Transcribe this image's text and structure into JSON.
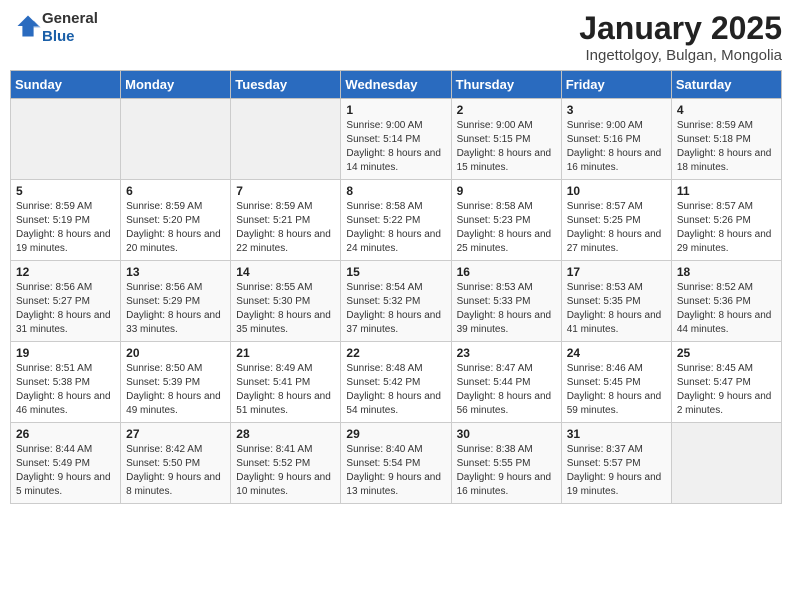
{
  "header": {
    "logo_general": "General",
    "logo_blue": "Blue",
    "title": "January 2025",
    "subtitle": "Ingettolgoy, Bulgan, Mongolia"
  },
  "days_of_week": [
    "Sunday",
    "Monday",
    "Tuesday",
    "Wednesday",
    "Thursday",
    "Friday",
    "Saturday"
  ],
  "weeks": [
    [
      {
        "day": "",
        "info": ""
      },
      {
        "day": "",
        "info": ""
      },
      {
        "day": "",
        "info": ""
      },
      {
        "day": "1",
        "info": "Sunrise: 9:00 AM\nSunset: 5:14 PM\nDaylight: 8 hours and 14 minutes."
      },
      {
        "day": "2",
        "info": "Sunrise: 9:00 AM\nSunset: 5:15 PM\nDaylight: 8 hours and 15 minutes."
      },
      {
        "day": "3",
        "info": "Sunrise: 9:00 AM\nSunset: 5:16 PM\nDaylight: 8 hours and 16 minutes."
      },
      {
        "day": "4",
        "info": "Sunrise: 8:59 AM\nSunset: 5:18 PM\nDaylight: 8 hours and 18 minutes."
      }
    ],
    [
      {
        "day": "5",
        "info": "Sunrise: 8:59 AM\nSunset: 5:19 PM\nDaylight: 8 hours and 19 minutes."
      },
      {
        "day": "6",
        "info": "Sunrise: 8:59 AM\nSunset: 5:20 PM\nDaylight: 8 hours and 20 minutes."
      },
      {
        "day": "7",
        "info": "Sunrise: 8:59 AM\nSunset: 5:21 PM\nDaylight: 8 hours and 22 minutes."
      },
      {
        "day": "8",
        "info": "Sunrise: 8:58 AM\nSunset: 5:22 PM\nDaylight: 8 hours and 24 minutes."
      },
      {
        "day": "9",
        "info": "Sunrise: 8:58 AM\nSunset: 5:23 PM\nDaylight: 8 hours and 25 minutes."
      },
      {
        "day": "10",
        "info": "Sunrise: 8:57 AM\nSunset: 5:25 PM\nDaylight: 8 hours and 27 minutes."
      },
      {
        "day": "11",
        "info": "Sunrise: 8:57 AM\nSunset: 5:26 PM\nDaylight: 8 hours and 29 minutes."
      }
    ],
    [
      {
        "day": "12",
        "info": "Sunrise: 8:56 AM\nSunset: 5:27 PM\nDaylight: 8 hours and 31 minutes."
      },
      {
        "day": "13",
        "info": "Sunrise: 8:56 AM\nSunset: 5:29 PM\nDaylight: 8 hours and 33 minutes."
      },
      {
        "day": "14",
        "info": "Sunrise: 8:55 AM\nSunset: 5:30 PM\nDaylight: 8 hours and 35 minutes."
      },
      {
        "day": "15",
        "info": "Sunrise: 8:54 AM\nSunset: 5:32 PM\nDaylight: 8 hours and 37 minutes."
      },
      {
        "day": "16",
        "info": "Sunrise: 8:53 AM\nSunset: 5:33 PM\nDaylight: 8 hours and 39 minutes."
      },
      {
        "day": "17",
        "info": "Sunrise: 8:53 AM\nSunset: 5:35 PM\nDaylight: 8 hours and 41 minutes."
      },
      {
        "day": "18",
        "info": "Sunrise: 8:52 AM\nSunset: 5:36 PM\nDaylight: 8 hours and 44 minutes."
      }
    ],
    [
      {
        "day": "19",
        "info": "Sunrise: 8:51 AM\nSunset: 5:38 PM\nDaylight: 8 hours and 46 minutes."
      },
      {
        "day": "20",
        "info": "Sunrise: 8:50 AM\nSunset: 5:39 PM\nDaylight: 8 hours and 49 minutes."
      },
      {
        "day": "21",
        "info": "Sunrise: 8:49 AM\nSunset: 5:41 PM\nDaylight: 8 hours and 51 minutes."
      },
      {
        "day": "22",
        "info": "Sunrise: 8:48 AM\nSunset: 5:42 PM\nDaylight: 8 hours and 54 minutes."
      },
      {
        "day": "23",
        "info": "Sunrise: 8:47 AM\nSunset: 5:44 PM\nDaylight: 8 hours and 56 minutes."
      },
      {
        "day": "24",
        "info": "Sunrise: 8:46 AM\nSunset: 5:45 PM\nDaylight: 8 hours and 59 minutes."
      },
      {
        "day": "25",
        "info": "Sunrise: 8:45 AM\nSunset: 5:47 PM\nDaylight: 9 hours and 2 minutes."
      }
    ],
    [
      {
        "day": "26",
        "info": "Sunrise: 8:44 AM\nSunset: 5:49 PM\nDaylight: 9 hours and 5 minutes."
      },
      {
        "day": "27",
        "info": "Sunrise: 8:42 AM\nSunset: 5:50 PM\nDaylight: 9 hours and 8 minutes."
      },
      {
        "day": "28",
        "info": "Sunrise: 8:41 AM\nSunset: 5:52 PM\nDaylight: 9 hours and 10 minutes."
      },
      {
        "day": "29",
        "info": "Sunrise: 8:40 AM\nSunset: 5:54 PM\nDaylight: 9 hours and 13 minutes."
      },
      {
        "day": "30",
        "info": "Sunrise: 8:38 AM\nSunset: 5:55 PM\nDaylight: 9 hours and 16 minutes."
      },
      {
        "day": "31",
        "info": "Sunrise: 8:37 AM\nSunset: 5:57 PM\nDaylight: 9 hours and 19 minutes."
      },
      {
        "day": "",
        "info": ""
      }
    ]
  ]
}
